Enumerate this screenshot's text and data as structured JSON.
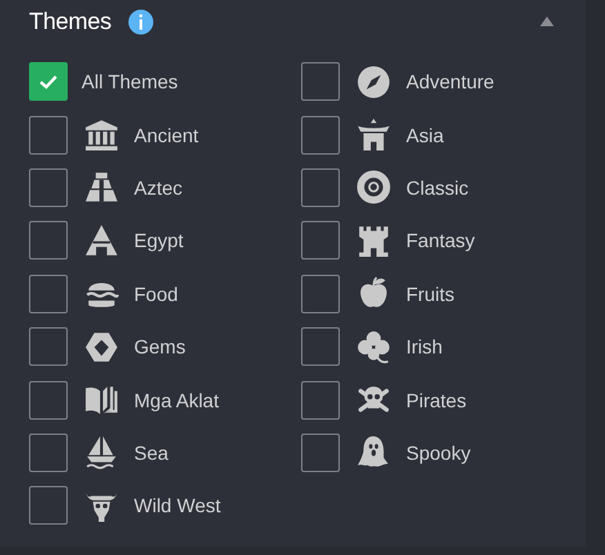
{
  "panel": {
    "title": "Themes",
    "expanded": true
  },
  "themes": [
    {
      "label": "All Themes",
      "checked": true
    },
    {
      "label": "Ancient",
      "checked": false
    },
    {
      "label": "Aztec",
      "checked": false
    },
    {
      "label": "Egypt",
      "checked": false
    },
    {
      "label": "Food",
      "checked": false
    },
    {
      "label": "Gems",
      "checked": false
    },
    {
      "label": "Mga Aklat",
      "checked": false
    },
    {
      "label": "Sea",
      "checked": false
    },
    {
      "label": "Wild West",
      "checked": false
    },
    {
      "label": "Adventure",
      "checked": false
    },
    {
      "label": "Asia",
      "checked": false
    },
    {
      "label": "Classic",
      "checked": false
    },
    {
      "label": "Fantasy",
      "checked": false
    },
    {
      "label": "Fruits",
      "checked": false
    },
    {
      "label": "Irish",
      "checked": false
    },
    {
      "label": "Pirates",
      "checked": false
    },
    {
      "label": "Spooky",
      "checked": false
    }
  ]
}
